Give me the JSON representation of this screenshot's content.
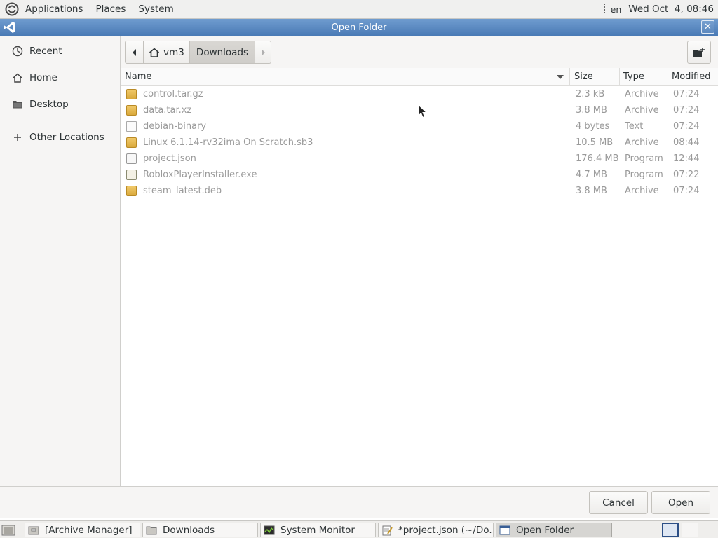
{
  "top_panel": {
    "menus": [
      "Applications",
      "Places",
      "System"
    ],
    "language": "en",
    "clock": "Wed Oct  4, 08:46"
  },
  "window": {
    "title": "Open Folder",
    "close_symbol": "✕"
  },
  "sidebar": {
    "items": [
      {
        "label": "Recent",
        "icon": "clock-icon"
      },
      {
        "label": "Home",
        "icon": "home-icon"
      },
      {
        "label": "Desktop",
        "icon": "desktop-folder-icon"
      },
      {
        "label": "Other Locations",
        "icon": "plus-icon"
      }
    ]
  },
  "pathbar": {
    "segments": [
      "vm3",
      "Downloads"
    ]
  },
  "columns": {
    "name": "Name",
    "size": "Size",
    "type": "Type",
    "modified": "Modified"
  },
  "files": [
    {
      "name": "control.tar.gz",
      "size": "2.3 kB",
      "type": "Archive",
      "modified": "07:24",
      "icon": "archive-icon"
    },
    {
      "name": "data.tar.xz",
      "size": "3.8 MB",
      "type": "Archive",
      "modified": "07:24",
      "icon": "archive-icon"
    },
    {
      "name": "debian-binary",
      "size": "4 bytes",
      "type": "Text",
      "modified": "07:24",
      "icon": "text-file-icon"
    },
    {
      "name": "Linux 6.1.14-rv32ima On Scratch.sb3",
      "size": "10.5 MB",
      "type": "Archive",
      "modified": "08:44",
      "icon": "archive-icon"
    },
    {
      "name": "project.json",
      "size": "176.4 MB",
      "type": "Program",
      "modified": "12:44",
      "icon": "script-file-icon"
    },
    {
      "name": "RobloxPlayerInstaller.exe",
      "size": "4.7 MB",
      "type": "Program",
      "modified": "07:22",
      "icon": "executable-icon"
    },
    {
      "name": "steam_latest.deb",
      "size": "3.8 MB",
      "type": "Archive",
      "modified": "07:24",
      "icon": "archive-icon"
    }
  ],
  "buttons": {
    "cancel": "Cancel",
    "open": "Open"
  },
  "taskbar": {
    "items": [
      {
        "label": "[Archive Manager]",
        "icon": "archive-manager-icon"
      },
      {
        "label": "Downloads",
        "icon": "folder-icon"
      },
      {
        "label": "System Monitor",
        "icon": "system-monitor-icon"
      },
      {
        "label": "*project.json (~/Do...",
        "icon": "text-editor-icon"
      },
      {
        "label": "Open Folder",
        "icon": "window-icon"
      }
    ]
  },
  "colors": {
    "titlebar": "#5b89c2",
    "dim_text": "#9a9a9a"
  }
}
